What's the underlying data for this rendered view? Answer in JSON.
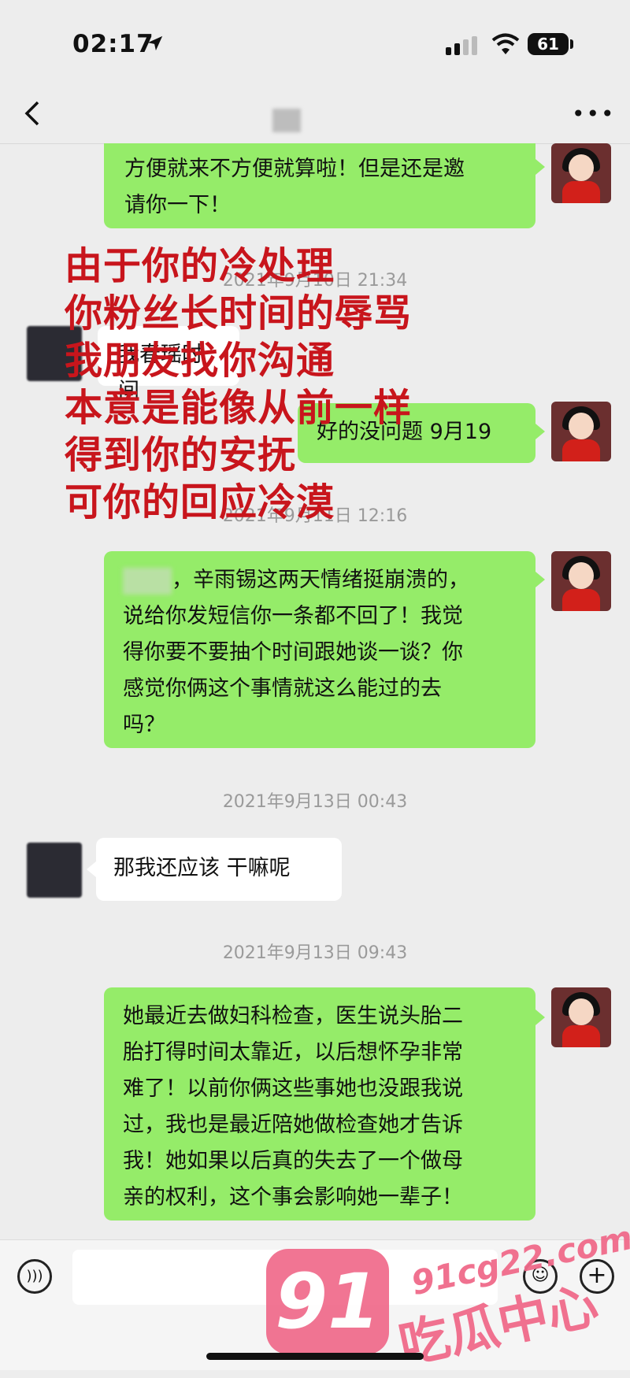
{
  "status_bar": {
    "time": "02:17",
    "battery": "61"
  },
  "messages": {
    "m1": [
      "方便就来不方便就算啦！但是还是邀",
      "请你一下！"
    ],
    "t1": "2021年9月10日 21:34",
    "m2": "我春瑶时间",
    "m3": "好的没问题 9月19",
    "t2": "2021年9月11日 12:16",
    "m4": [
      "，辛雨锡这两天情绪挺崩溃的，",
      "说给你发短信你一条都不回了！我觉",
      "得你要不要抽个时间跟她谈一谈？你",
      "感觉你俩这个事情就这么能过的去",
      "吗？"
    ],
    "t3": "2021年9月13日 00:43",
    "m5": "那我还应该  干嘛呢",
    "t4": "2021年9月13日 09:43",
    "m6": [
      "她最近去做妇科检查，医生说头胎二",
      "胎打得时间太靠近，以后想怀孕非常",
      "难了！以前你俩这些事她也没跟我说",
      "过，我也是最近陪她做检查她才告诉",
      "我！她如果以后真的失去了一个做母",
      "亲的权利，这个事会影响她一辈子！"
    ]
  },
  "overlay": [
    "由于你的冷处理",
    "你粉丝长时间的辱骂",
    "我朋友找你沟通",
    "本意是能像从前一样",
    "得到你的安抚",
    "可你的回应冷漠"
  ],
  "watermark": {
    "number": "91",
    "url": "91cg22.com",
    "name": "吃瓜中心"
  },
  "colors": {
    "bubble_green": "#95ec69",
    "overlay_red": "#c8151c",
    "watermark_pink": "#f06a8a"
  }
}
